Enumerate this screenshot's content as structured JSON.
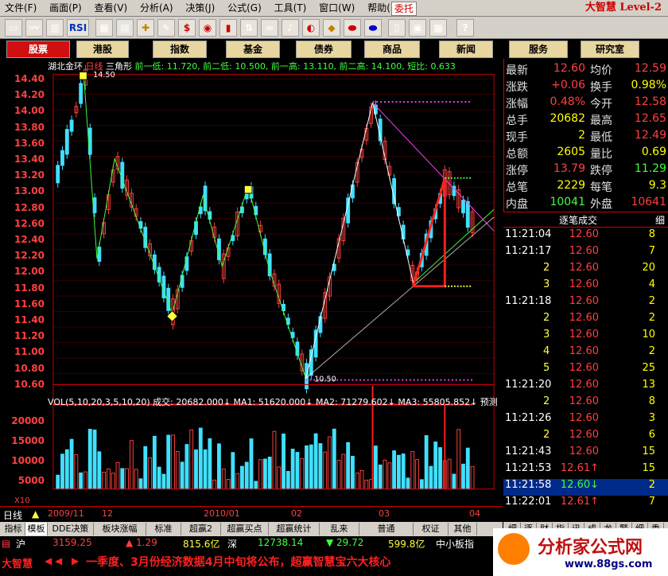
{
  "menu": [
    "文件(F)",
    "画面(P)",
    "查看(V)",
    "分析(A)",
    "决策(J)",
    "公式(G)",
    "工具(T)",
    "窗口(W)",
    "帮助(H)"
  ],
  "delegate_label": "委托",
  "brand": "大智慧 Level-2",
  "toolbar_icons": [
    "open-icon",
    "chart-icon",
    "kline-icon",
    "rsi-icon",
    "table-icon",
    "calendar-icon",
    "crosshair-icon",
    "ruler-icon",
    "dollar-icon",
    "traffic-icon",
    "bars-icon",
    "sort-icon",
    "binocular-icon",
    "bell-icon",
    "info-icon",
    "diamond-icon",
    "pill-icon",
    "pill2-icon",
    "book-icon",
    "layout-icon",
    "grid-icon",
    "help-icon"
  ],
  "toolbar_rsi": "RSI",
  "market_buttons": [
    "股票",
    "港股",
    "指数",
    "基金",
    "债券",
    "商品",
    "新闻",
    "服务",
    "研究室"
  ],
  "chart": {
    "title_stock": "湖北金环",
    "title_period": "日线",
    "title_pattern": "三角形",
    "title_metrics": "前一低: 11.720, 前二低: 10.500, 前一高: 13.110, 前二高: 14.100, 短比: 0.633",
    "price_ticks": [
      "14.40",
      "14.20",
      "14.00",
      "13.80",
      "13.60",
      "13.40",
      "13.20",
      "13.00",
      "12.80",
      "12.60",
      "12.40",
      "12.20",
      "12.00",
      "11.80",
      "11.60",
      "11.40",
      "11.20",
      "11.00",
      "10.80",
      "10.60"
    ],
    "high_label": "14.50",
    "low_label": "10.50",
    "vol_title": "VOL(5,10,20,3,5,10,20) 成交: 20682.000↓ MA1: 51620.000↓ MA2: 71279.602↓ MA3: 55805.852↓ 预测",
    "vol_ticks": [
      "20000",
      "15000",
      "10000",
      "5000"
    ],
    "vol_unit": "X10",
    "date_labels": [
      "2009/11",
      "12",
      "2010/01",
      "02",
      "03",
      "04"
    ],
    "period_tag": "日线"
  },
  "quote": [
    {
      "l1": "最新",
      "v1": "12.60",
      "c1": "#ff4040",
      "l2": "均价",
      "v2": "12.59",
      "c2": "#ff4040"
    },
    {
      "l1": "涨跌",
      "v1": "+0.06",
      "c1": "#ff4040",
      "l2": "换手",
      "v2": "0.98%",
      "c2": "#ffff00"
    },
    {
      "l1": "涨幅",
      "v1": "0.48%",
      "c1": "#ff4040",
      "l2": "今开",
      "v2": "12.58",
      "c2": "#ff4040"
    },
    {
      "l1": "总手",
      "v1": "20682",
      "c1": "#ffff00",
      "l2": "最高",
      "v2": "12.65",
      "c2": "#ff4040"
    },
    {
      "l1": "现手",
      "v1": "2",
      "c1": "#ffff00",
      "l2": "最低",
      "v2": "12.49",
      "c2": "#ff4040"
    },
    {
      "l1": "总额",
      "v1": "2605",
      "c1": "#ffff00",
      "l2": "量比",
      "v2": "0.69",
      "c2": "#ffff00"
    },
    {
      "l1": "涨停",
      "v1": "13.79",
      "c1": "#ff4040",
      "l2": "跌停",
      "v2": "11.29",
      "c2": "#40ff40"
    },
    {
      "l1": "总笔",
      "v1": "2229",
      "c1": "#ffff00",
      "l2": "每笔",
      "v2": "9.3",
      "c2": "#ffff00"
    },
    {
      "l1": "内盘",
      "v1": "10041",
      "c1": "#40ff40",
      "l2": "外盘",
      "v2": "10641",
      "c2": "#ff4040"
    }
  ],
  "trades_header": "逐笔成交",
  "trades_side": "细",
  "trades": [
    {
      "t": "11:21:04",
      "p": "12.60",
      "q": "8"
    },
    {
      "t": "11:21:17",
      "p": "12.60",
      "q": "7"
    },
    {
      "t": "2",
      "p": "12.60",
      "q": "20"
    },
    {
      "t": "3",
      "p": "12.60",
      "q": "4"
    },
    {
      "t": "11:21:18",
      "p": "12.60",
      "q": "2"
    },
    {
      "t": "2",
      "p": "12.60",
      "q": "2"
    },
    {
      "t": "3",
      "p": "12.60",
      "q": "10"
    },
    {
      "t": "4",
      "p": "12.60",
      "q": "2"
    },
    {
      "t": "5",
      "p": "12.60",
      "q": "25"
    },
    {
      "t": "11:21:20",
      "p": "12.60",
      "q": "13"
    },
    {
      "t": "2",
      "p": "12.60",
      "q": "8"
    },
    {
      "t": "11:21:26",
      "p": "12.60",
      "q": "3"
    },
    {
      "t": "2",
      "p": "12.60",
      "q": "6"
    },
    {
      "t": "11:21:43",
      "p": "12.60",
      "q": "15"
    },
    {
      "t": "11:21:53",
      "p": "12.61↑",
      "q": "15"
    },
    {
      "t": "11:21:58",
      "p": "12.60↓",
      "q": "2"
    },
    {
      "t": "11:22:01",
      "p": "12.61↑",
      "q": "7"
    }
  ],
  "bottom_tabs": [
    "指标",
    "模板",
    "DDE决策",
    "板块涨幅",
    "标准",
    "超赢2",
    "超赢买点",
    "超赢统计",
    "乱来",
    "普通",
    "权证",
    "其他"
  ],
  "right_tabs": [
    "细",
    "逐",
    "财",
    "指",
    "讯",
    "成",
    "龙",
    "警",
    "细",
    "委"
  ],
  "index_bar": {
    "sh_label": "沪",
    "sh_val": "3159.25",
    "sh_chg": "▲ 1.29",
    "sh_amt": "815.6亿",
    "sz_label": "深",
    "sz_val": "12738.14",
    "sz_chg": "▼ 29.72",
    "sz_amt": "599.8亿",
    "sme_label": "中小板指",
    "sme_val": "5"
  },
  "news": {
    "logo": "大智慧",
    "ticker": "一季度、3月份经济数据4月中旬将公布，超赢智慧宝六大核心"
  },
  "watermark": {
    "text": "分析家公式网",
    "url": "www.88gs.com"
  }
}
